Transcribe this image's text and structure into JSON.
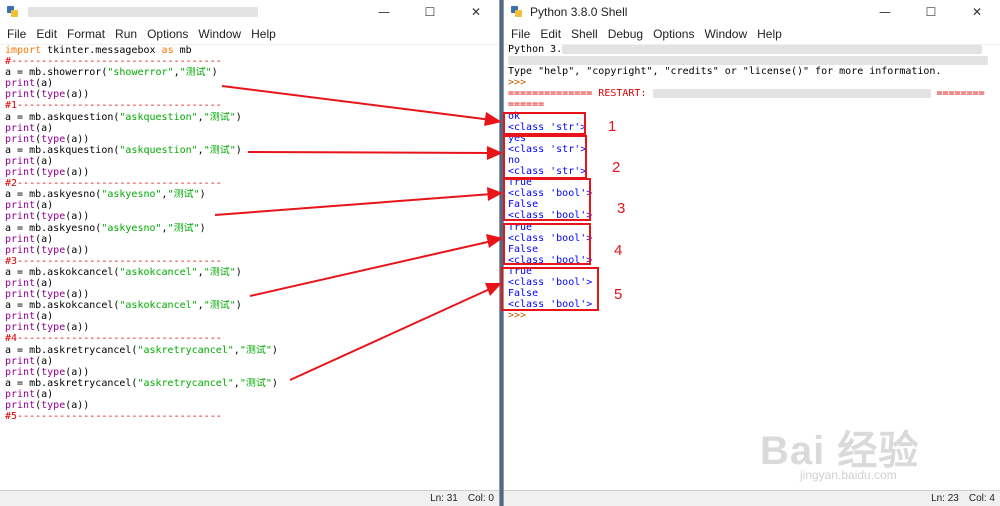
{
  "editor": {
    "menu": [
      "File",
      "Edit",
      "Format",
      "Run",
      "Options",
      "Window",
      "Help"
    ],
    "controls": {
      "minimize": "—",
      "maximize": "☐",
      "close": "✕"
    },
    "status": {
      "line": "Ln: 31",
      "col": "Col: 0"
    },
    "lines": [
      [
        [
          "kw",
          "import"
        ],
        [
          "df",
          " tkinter.messagebox "
        ],
        [
          "kw",
          "as"
        ],
        [
          "df",
          " mb"
        ]
      ],
      [
        [
          "cm",
          "#-----------------------------------"
        ]
      ],
      [
        [
          "df",
          "a = mb.showerror("
        ],
        [
          "str",
          "\"showerror\""
        ],
        [
          "df",
          ","
        ],
        [
          "str",
          "\"测试\""
        ],
        [
          "df",
          ")"
        ]
      ],
      [
        [
          "bi",
          "print"
        ],
        [
          "df",
          "(a)"
        ]
      ],
      [
        [
          "bi",
          "print"
        ],
        [
          "df",
          "("
        ],
        [
          "bi",
          "type"
        ],
        [
          "df",
          "(a))"
        ]
      ],
      [
        [
          "cm",
          "#1----------------------------------"
        ]
      ],
      [
        [
          "df",
          "a = mb.askquestion("
        ],
        [
          "str",
          "\"askquestion\""
        ],
        [
          "df",
          ","
        ],
        [
          "str",
          "\"测试\""
        ],
        [
          "df",
          ")"
        ]
      ],
      [
        [
          "bi",
          "print"
        ],
        [
          "df",
          "(a)"
        ]
      ],
      [
        [
          "bi",
          "print"
        ],
        [
          "df",
          "("
        ],
        [
          "bi",
          "type"
        ],
        [
          "df",
          "(a))"
        ]
      ],
      [
        [
          "df",
          "a = mb.askquestion("
        ],
        [
          "str",
          "\"askquestion\""
        ],
        [
          "df",
          ","
        ],
        [
          "str",
          "\"测试\""
        ],
        [
          "df",
          ")"
        ]
      ],
      [
        [
          "bi",
          "print"
        ],
        [
          "df",
          "(a)"
        ]
      ],
      [
        [
          "bi",
          "print"
        ],
        [
          "df",
          "("
        ],
        [
          "bi",
          "type"
        ],
        [
          "df",
          "(a))"
        ]
      ],
      [
        [
          "cm",
          "#2----------------------------------"
        ]
      ],
      [
        [
          "df",
          "a = mb.askyesno("
        ],
        [
          "str",
          "\"askyesno\""
        ],
        [
          "df",
          ","
        ],
        [
          "str",
          "\"测试\""
        ],
        [
          "df",
          ")"
        ]
      ],
      [
        [
          "bi",
          "print"
        ],
        [
          "df",
          "(a)"
        ]
      ],
      [
        [
          "bi",
          "print"
        ],
        [
          "df",
          "("
        ],
        [
          "bi",
          "type"
        ],
        [
          "df",
          "(a))"
        ]
      ],
      [
        [
          "df",
          "a = mb.askyesno("
        ],
        [
          "str",
          "\"askyesno\""
        ],
        [
          "df",
          ","
        ],
        [
          "str",
          "\"测试\""
        ],
        [
          "df",
          ")"
        ]
      ],
      [
        [
          "bi",
          "print"
        ],
        [
          "df",
          "(a)"
        ]
      ],
      [
        [
          "bi",
          "print"
        ],
        [
          "df",
          "("
        ],
        [
          "bi",
          "type"
        ],
        [
          "df",
          "(a))"
        ]
      ],
      [
        [
          "cm",
          "#3----------------------------------"
        ]
      ],
      [
        [
          "df",
          "a = mb.askokcancel("
        ],
        [
          "str",
          "\"askokcancel\""
        ],
        [
          "df",
          ","
        ],
        [
          "str",
          "\"测试\""
        ],
        [
          "df",
          ")"
        ]
      ],
      [
        [
          "bi",
          "print"
        ],
        [
          "df",
          "(a)"
        ]
      ],
      [
        [
          "bi",
          "print"
        ],
        [
          "df",
          "("
        ],
        [
          "bi",
          "type"
        ],
        [
          "df",
          "(a))"
        ]
      ],
      [
        [
          "df",
          "a = mb.askokcancel("
        ],
        [
          "str",
          "\"askokcancel\""
        ],
        [
          "df",
          ","
        ],
        [
          "str",
          "\"测试\""
        ],
        [
          "df",
          ")"
        ]
      ],
      [
        [
          "bi",
          "print"
        ],
        [
          "df",
          "(a)"
        ]
      ],
      [
        [
          "bi",
          "print"
        ],
        [
          "df",
          "("
        ],
        [
          "bi",
          "type"
        ],
        [
          "df",
          "(a))"
        ]
      ],
      [
        [
          "cm",
          "#4----------------------------------"
        ]
      ],
      [
        [
          "df",
          "a = mb.askretrycancel("
        ],
        [
          "str",
          "\"askretrycancel\""
        ],
        [
          "df",
          ","
        ],
        [
          "str",
          "\"测试\""
        ],
        [
          "df",
          ")"
        ]
      ],
      [
        [
          "bi",
          "print"
        ],
        [
          "df",
          "(a)"
        ]
      ],
      [
        [
          "bi",
          "print"
        ],
        [
          "df",
          "("
        ],
        [
          "bi",
          "type"
        ],
        [
          "df",
          "(a))"
        ]
      ],
      [
        [
          "df",
          "a = mb.askretrycancel("
        ],
        [
          "str",
          "\"askretrycancel\""
        ],
        [
          "df",
          ","
        ],
        [
          "str",
          "\"测试\""
        ],
        [
          "df",
          ")"
        ]
      ],
      [
        [
          "bi",
          "print"
        ],
        [
          "df",
          "(a)"
        ]
      ],
      [
        [
          "bi",
          "print"
        ],
        [
          "df",
          "("
        ],
        [
          "bi",
          "type"
        ],
        [
          "df",
          "(a))"
        ]
      ],
      [
        [
          "cm",
          "#5----------------------------------"
        ]
      ]
    ]
  },
  "shell": {
    "title": "Python 3.8.0 Shell",
    "menu": [
      "File",
      "Edit",
      "Shell",
      "Debug",
      "Options",
      "Window",
      "Help"
    ],
    "controls": {
      "minimize": "—",
      "maximize": "☐",
      "close": "✕"
    },
    "status": {
      "line": "Ln: 23",
      "col": "Col: 4"
    },
    "lines": [
      [
        [
          "df",
          "Python 3."
        ]
      ],
      [
        [
          "df",
          ""
        ]
      ],
      [
        [
          "df",
          "Type \"help\", \"copyright\", \"credits\" or \"license()\" for more information."
        ]
      ],
      [
        [
          "prompt",
          ">>>"
        ]
      ],
      [
        [
          "cm-restart",
          "============== RESTART: "
        ]
      ],
      [
        [
          "cm-restart",
          "======"
        ]
      ],
      [
        [
          "out",
          "ok"
        ]
      ],
      [
        [
          "out",
          "<class 'str'>"
        ]
      ],
      [
        [
          "out",
          "yes"
        ]
      ],
      [
        [
          "out",
          "<class 'str'>"
        ]
      ],
      [
        [
          "out",
          "no"
        ]
      ],
      [
        [
          "out",
          "<class 'str'>"
        ]
      ],
      [
        [
          "out",
          "True"
        ]
      ],
      [
        [
          "out",
          "<class 'bool'>"
        ]
      ],
      [
        [
          "out",
          "False"
        ]
      ],
      [
        [
          "out",
          "<class 'bool'>"
        ]
      ],
      [
        [
          "out",
          "True"
        ]
      ],
      [
        [
          "out",
          "<class 'bool'>"
        ]
      ],
      [
        [
          "out",
          "False"
        ]
      ],
      [
        [
          "out",
          "<class 'bool'>"
        ]
      ],
      [
        [
          "out",
          "True"
        ]
      ],
      [
        [
          "out",
          "<class 'bool'>"
        ]
      ],
      [
        [
          "out",
          "False"
        ]
      ],
      [
        [
          "out",
          "<class 'bool'>"
        ]
      ],
      [
        [
          "prompt",
          ">>>"
        ]
      ]
    ],
    "restart_tail": "========"
  },
  "annotations": [
    "1",
    "2",
    "3",
    "4",
    "5"
  ],
  "watermark": {
    "brand": "Bai 经验",
    "url": "jingyan.baidu.com"
  },
  "colors": {
    "annotation": "#e8141a",
    "keyword": "#ff7700",
    "builtin": "#900090",
    "string": "#00aa00",
    "comment": "#dd0000",
    "output": "#0000ff"
  }
}
